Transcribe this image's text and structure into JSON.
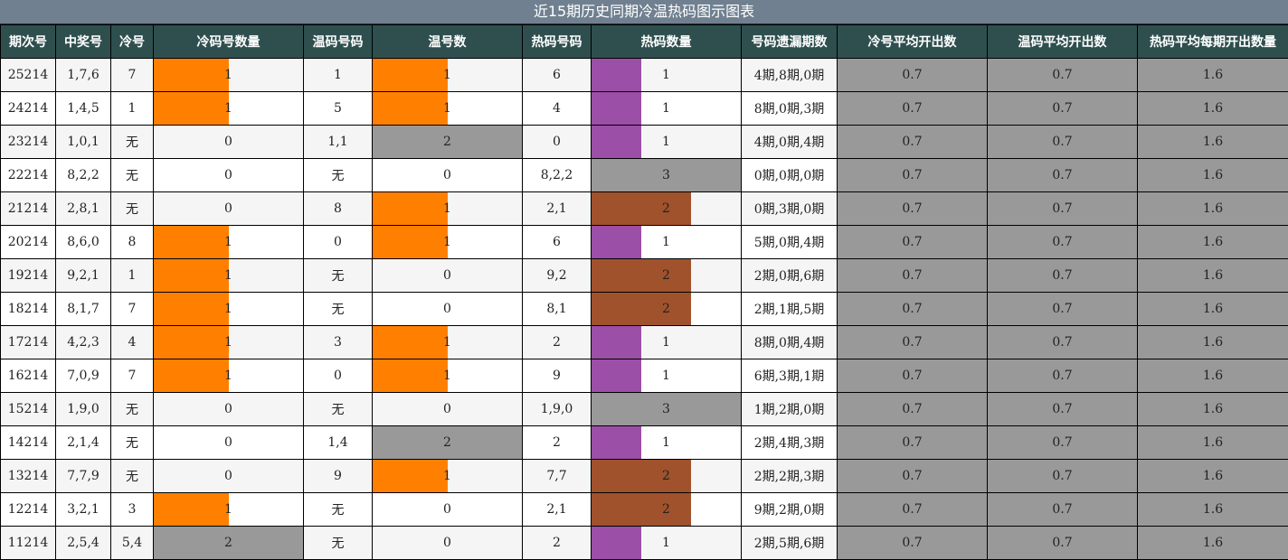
{
  "title": "近15期历史同期冷温热码图示图表",
  "headers": [
    "期次号",
    "中奖号",
    "冷号",
    "冷码号数量",
    "温码号码",
    "温号数",
    "热码号码",
    "热码数量",
    "号码遗漏期数",
    "冷号平均开出数",
    "温码平均开出数",
    "热码平均每期开出数量"
  ],
  "colors": {
    "header_bg": "#2f4f4f",
    "title_bg": "#708090",
    "cold": "#ff8000",
    "warm": "#ff8000",
    "hot_1": "#9b4fa6",
    "hot_2": "#a0522d",
    "gray": "#999999"
  },
  "rows": [
    {
      "period": "25214",
      "num": "1,7,6",
      "cold": "7",
      "cold_count": 1,
      "warm": "1",
      "warm_count": 1,
      "hot": "6",
      "hot_count": 1,
      "miss": "4期,8期,0期",
      "cold_avg": "0.7",
      "warm_avg": "0.7",
      "hot_avg": "1.6"
    },
    {
      "period": "24214",
      "num": "1,4,5",
      "cold": "1",
      "cold_count": 1,
      "warm": "5",
      "warm_count": 1,
      "hot": "4",
      "hot_count": 1,
      "miss": "8期,0期,3期",
      "cold_avg": "0.7",
      "warm_avg": "0.7",
      "hot_avg": "1.6"
    },
    {
      "period": "23214",
      "num": "1,0,1",
      "cold": "无",
      "cold_count": 0,
      "warm": "1,1",
      "warm_count": 2,
      "hot": "0",
      "hot_count": 1,
      "miss": "4期,0期,4期",
      "cold_avg": "0.7",
      "warm_avg": "0.7",
      "hot_avg": "1.6"
    },
    {
      "period": "22214",
      "num": "8,2,2",
      "cold": "无",
      "cold_count": 0,
      "warm": "无",
      "warm_count": 0,
      "hot": "8,2,2",
      "hot_count": 3,
      "miss": "0期,0期,0期",
      "cold_avg": "0.7",
      "warm_avg": "0.7",
      "hot_avg": "1.6"
    },
    {
      "period": "21214",
      "num": "2,8,1",
      "cold": "无",
      "cold_count": 0,
      "warm": "8",
      "warm_count": 1,
      "hot": "2,1",
      "hot_count": 2,
      "miss": "0期,3期,0期",
      "cold_avg": "0.7",
      "warm_avg": "0.7",
      "hot_avg": "1.6"
    },
    {
      "period": "20214",
      "num": "8,6,0",
      "cold": "8",
      "cold_count": 1,
      "warm": "0",
      "warm_count": 1,
      "hot": "6",
      "hot_count": 1,
      "miss": "5期,0期,4期",
      "cold_avg": "0.7",
      "warm_avg": "0.7",
      "hot_avg": "1.6"
    },
    {
      "period": "19214",
      "num": "9,2,1",
      "cold": "1",
      "cold_count": 1,
      "warm": "无",
      "warm_count": 0,
      "hot": "9,2",
      "hot_count": 2,
      "miss": "2期,0期,6期",
      "cold_avg": "0.7",
      "warm_avg": "0.7",
      "hot_avg": "1.6"
    },
    {
      "period": "18214",
      "num": "8,1,7",
      "cold": "7",
      "cold_count": 1,
      "warm": "无",
      "warm_count": 0,
      "hot": "8,1",
      "hot_count": 2,
      "miss": "2期,1期,5期",
      "cold_avg": "0.7",
      "warm_avg": "0.7",
      "hot_avg": "1.6"
    },
    {
      "period": "17214",
      "num": "4,2,3",
      "cold": "4",
      "cold_count": 1,
      "warm": "3",
      "warm_count": 1,
      "hot": "2",
      "hot_count": 1,
      "miss": "8期,0期,4期",
      "cold_avg": "0.7",
      "warm_avg": "0.7",
      "hot_avg": "1.6"
    },
    {
      "period": "16214",
      "num": "7,0,9",
      "cold": "7",
      "cold_count": 1,
      "warm": "0",
      "warm_count": 1,
      "hot": "9",
      "hot_count": 1,
      "miss": "6期,3期,1期",
      "cold_avg": "0.7",
      "warm_avg": "0.7",
      "hot_avg": "1.6"
    },
    {
      "period": "15214",
      "num": "1,9,0",
      "cold": "无",
      "cold_count": 0,
      "warm": "无",
      "warm_count": 0,
      "hot": "1,9,0",
      "hot_count": 3,
      "miss": "1期,2期,0期",
      "cold_avg": "0.7",
      "warm_avg": "0.7",
      "hot_avg": "1.6"
    },
    {
      "period": "14214",
      "num": "2,1,4",
      "cold": "无",
      "cold_count": 0,
      "warm": "1,4",
      "warm_count": 2,
      "hot": "2",
      "hot_count": 1,
      "miss": "2期,4期,3期",
      "cold_avg": "0.7",
      "warm_avg": "0.7",
      "hot_avg": "1.6"
    },
    {
      "period": "13214",
      "num": "7,7,9",
      "cold": "无",
      "cold_count": 0,
      "warm": "9",
      "warm_count": 1,
      "hot": "7,7",
      "hot_count": 2,
      "miss": "2期,2期,3期",
      "cold_avg": "0.7",
      "warm_avg": "0.7",
      "hot_avg": "1.6"
    },
    {
      "period": "12214",
      "num": "3,2,1",
      "cold": "3",
      "cold_count": 1,
      "warm": "无",
      "warm_count": 0,
      "hot": "2,1",
      "hot_count": 2,
      "miss": "9期,2期,0期",
      "cold_avg": "0.7",
      "warm_avg": "0.7",
      "hot_avg": "1.6"
    },
    {
      "period": "11214",
      "num": "2,5,4",
      "cold": "5,4",
      "cold_count": 2,
      "warm": "无",
      "warm_count": 0,
      "hot": "2",
      "hot_count": 1,
      "miss": "2期,5期,6期",
      "cold_avg": "0.7",
      "warm_avg": "0.7",
      "hot_avg": "1.6"
    }
  ]
}
